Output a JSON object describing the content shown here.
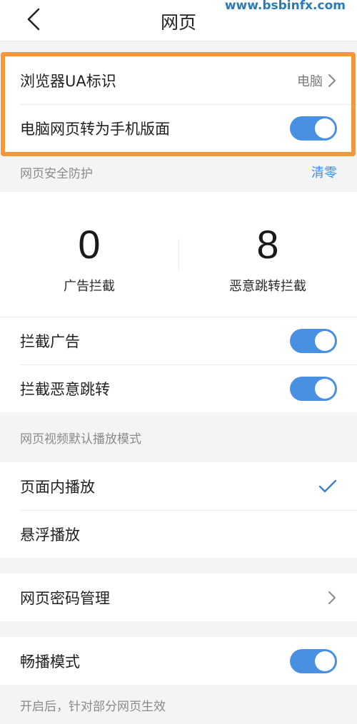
{
  "header": {
    "title": "网页",
    "back_icon": "chevron-left-icon",
    "watermark": "www.bsbinfx.com"
  },
  "ua_section": {
    "ua_label": "浏览器UA标识",
    "ua_value": "电脑",
    "desktop_to_mobile_label": "电脑网页转为手机版面",
    "desktop_to_mobile_on": true
  },
  "security": {
    "title": "网页安全防护",
    "clear_label": "清零",
    "ads_blocked_count": "0",
    "ads_blocked_label": "广告拦截",
    "redirects_blocked_count": "8",
    "redirects_blocked_label": "恶意跳转拦截",
    "block_ads_label": "拦截广告",
    "block_ads_on": true,
    "block_redirects_label": "拦截恶意跳转",
    "block_redirects_on": true
  },
  "video": {
    "title": "网页视频默认播放模式",
    "inline_label": "页面内播放",
    "inline_selected": true,
    "floating_label": "悬浮播放"
  },
  "password": {
    "label": "网页密码管理"
  },
  "smooth": {
    "label": "畅播模式",
    "on": true,
    "description": "开启后，针对部分网页生效"
  },
  "colors": {
    "toggle_on": "#4a90e2",
    "accent_link": "#3b8eea",
    "highlight_border": "#f5963b",
    "watermark": "#2a7ab7"
  }
}
